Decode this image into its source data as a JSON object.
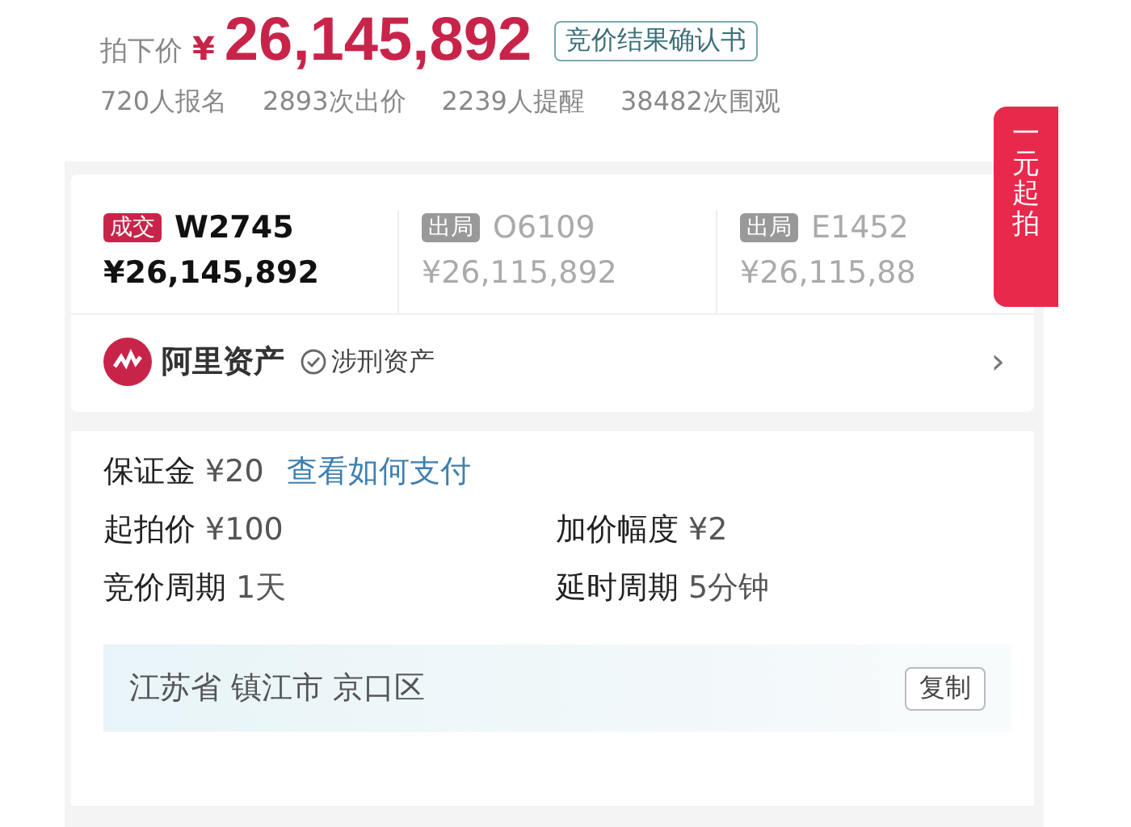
{
  "header": {
    "price_label": "拍下价",
    "currency": "¥",
    "price": "26,145,892",
    "certificate": "竞价结果确认书"
  },
  "stats": [
    "720人报名",
    "2893次出价",
    "2239人提醒",
    "38482次围观"
  ],
  "side_tab": "一元起拍",
  "bids": [
    {
      "kind": "deal",
      "tag": "成交",
      "code": "W2745",
      "price": "¥26,145,892"
    },
    {
      "kind": "out",
      "tag": "出局",
      "code": "O6109",
      "price": "¥26,115,892"
    },
    {
      "kind": "out",
      "tag": "出局",
      "code": "E1452",
      "price": "¥26,115,88"
    }
  ],
  "platform": {
    "name": "阿里资产",
    "badge": "涉刑资产",
    "chevron": "›"
  },
  "details": [
    {
      "label": "保证金",
      "value": "¥20",
      "link": "查看如何支付"
    },
    {
      "label": "起拍价",
      "value": "¥100"
    },
    {
      "label": "加价幅度",
      "value": "¥2"
    },
    {
      "label": "竞价周期",
      "value": "1天"
    },
    {
      "label": "延时周期",
      "value": "5分钟"
    }
  ],
  "location": {
    "address": "江苏省 镇江市 京口区",
    "copy_button": "复制"
  }
}
